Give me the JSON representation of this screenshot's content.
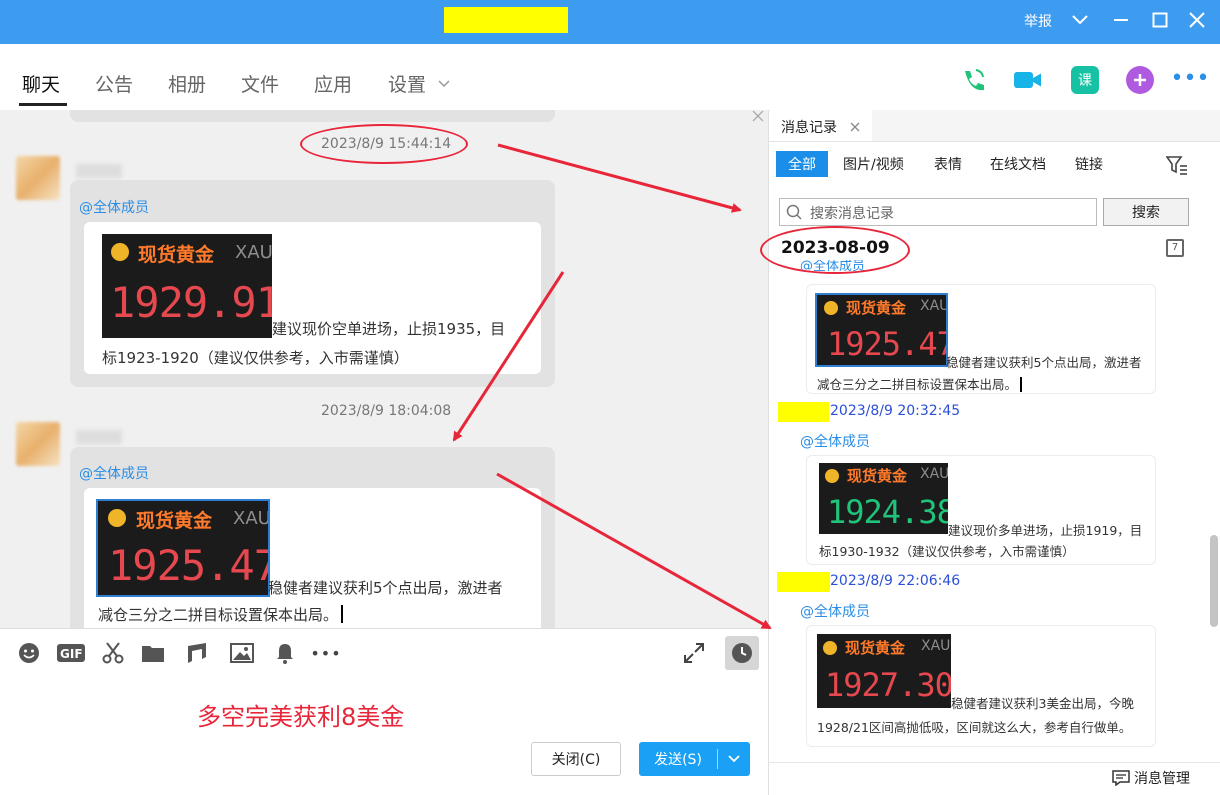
{
  "title_bar": {
    "report_label": "举报",
    "dropdown_icon": "chevron-down",
    "min_icon": "minimize",
    "max_icon": "maximize",
    "close_icon": "close"
  },
  "tabs": {
    "chat": "聊天",
    "announcement": "公告",
    "album": "相册",
    "files": "文件",
    "apps": "应用",
    "settings": "设置"
  },
  "chat": {
    "timestamp1": "2023/8/9 15:44:14",
    "timestamp2": "2023/8/9 18:04:08",
    "msg1": {
      "mention": "@全体成员",
      "img_title": "现货黄金",
      "img_code": "XAU",
      "img_price": "1929.91",
      "text_line1": "建议现价空单进场，止损1935，目",
      "text_line2": "标1923-1920（建议仅供参考，入市需谨慎）"
    },
    "msg2": {
      "mention": "@全体成员",
      "img_title": "现货黄金",
      "img_code": "XAU",
      "img_price": "1925.47",
      "text_line1": "稳健者建议获利5个点出局，激进者",
      "text_line2": "减仓三分之二拼目标设置保本出局。"
    }
  },
  "input": {
    "text": "多空完美获利8美金",
    "close_btn": "关闭(C)",
    "send_btn": "发送(S)"
  },
  "history": {
    "tab_label": "消息记录",
    "filters": [
      "全部",
      "图片/视频",
      "表情",
      "在线文档",
      "链接"
    ],
    "search_placeholder": "搜索消息记录",
    "search_btn": "搜索",
    "date": "2023-08-09",
    "calendar_num": "7",
    "partial_mention": "@全体成员",
    "entry1": {
      "img_title": "现货黄金",
      "img_code": "XAU",
      "img_price": "1925.47",
      "text_line1": "稳健者建议获利5个点出局，激进者",
      "text_line2": "减仓三分之二拼目标设置保本出局。"
    },
    "entry2": {
      "ts": "2023/8/9 20:32:45",
      "mention": "@全体成员",
      "img_title": "现货黄金",
      "img_code": "XAU",
      "img_price": "1924.38",
      "text_line1": "建议现价多单进场，止损1919，目",
      "text_line2": "标1930-1932（建议仅供参考，入市需谨慎）"
    },
    "entry3": {
      "ts": "2023/8/9 22:06:46",
      "mention": "@全体成员",
      "img_title": "现货黄金",
      "img_code": "XAU",
      "img_price": "1927.30",
      "text_line1": "稳健者建议获利3美金出局，今晚",
      "text_line2": "1928/21区间高抛低吸，区间就这么大，参考自行做单。"
    },
    "manage_label": "消息管理"
  },
  "colors": {
    "titlebar": "#3d9bf0",
    "accent": "#1aa1f5",
    "annotation": "#e8263a",
    "mention": "#2a8de6"
  }
}
